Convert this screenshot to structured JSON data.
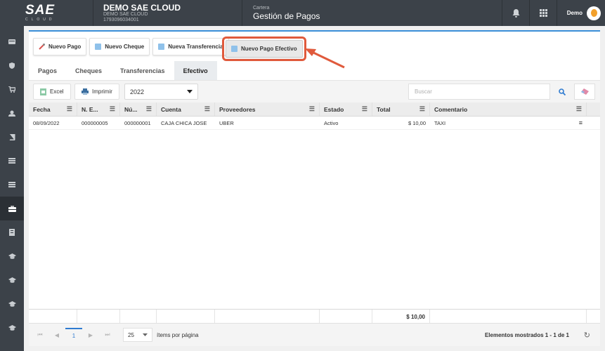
{
  "header": {
    "logo_text": "SAE",
    "logo_sub": "CLOUD",
    "company_name": "DEMO SAE CLOUD",
    "company_line2": "DEMO SAE CLOUD",
    "company_id": "1793096034001",
    "module_top": "Cartera",
    "module_title": "Gestión de Pagos",
    "bell_icon": "bell-icon",
    "apps_icon": "grid-apps-icon",
    "user_name": "Demo"
  },
  "sidebar": {
    "items": [
      "wallet-icon",
      "shield-icon",
      "cart-icon",
      "user-icon",
      "book-icon",
      "list-icon",
      "list-icon",
      "briefcase-icon",
      "document-icon",
      "graduation-icon",
      "graduation-icon",
      "graduation-icon",
      "graduation-icon"
    ],
    "active_index": 7
  },
  "actions": {
    "nuevo_pago": "Nuevo Pago",
    "nuevo_cheque": "Nuevo Cheque",
    "nueva_transferencia": "Nueva Transferencia",
    "nuevo_pago_efectivo": "Nuevo Pago Efectivo"
  },
  "tabs": [
    "Pagos",
    "Cheques",
    "Transferencias",
    "Efectivo"
  ],
  "active_tab": "Efectivo",
  "toolbar": {
    "excel": "Excel",
    "imprimir": "Imprimir",
    "year": "2022",
    "search_placeholder": "Buscar"
  },
  "grid": {
    "columns": [
      "Fecha",
      "N. E...",
      "Nú...",
      "Cuenta",
      "Proveedores",
      "Estado",
      "Total",
      "Comentario"
    ],
    "rows": [
      [
        "08/09/2022",
        "000000005",
        "000000001",
        "CAJA CHICA JOSE",
        "UBER",
        "Activo",
        "$ 10,00",
        "TAXI"
      ]
    ],
    "footer_total": "$ 10,00"
  },
  "pager": {
    "current_page": "1",
    "page_size": "25",
    "page_size_label": "ítems por página",
    "info": "Elementos mostrados 1 - 1 de 1"
  },
  "colors": {
    "topbar": "#3c4249",
    "accent": "#3a8fd8",
    "highlight": "#e05a3c"
  }
}
